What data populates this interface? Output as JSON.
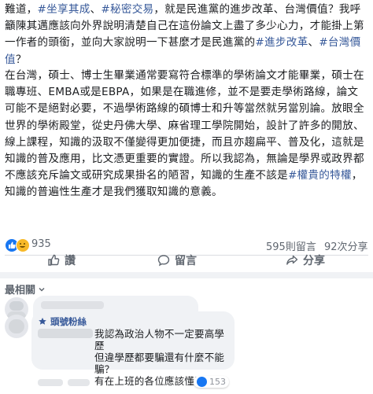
{
  "post": {
    "p1_prefix": "難道，",
    "tags": [
      "#坐享其成",
      "#秘密交易"
    ],
    "p1_middle": "，就是民進黨的進步改革、台灣價值？我呼籲陳其邁應該向外界說明清楚自己在這份論文上盡了多少心力，才能掛上第一作者的頭銜，並向大家說明一下甚麼才是民進黨的",
    "tags2": [
      "#進步改革",
      "#台灣價值"
    ],
    "p1_suffix": "？",
    "p2_a": "在台灣，碩士、博士生畢業通常要寫符合標準的學術論文才能畢業，碩士在職專班、EMBA或是EBPA，如果是在職進修，並不是要走學術路線，論文可能不是絕對必要，不過學術路線的碩博士和升等當然就另當別論。放眼全世界的學術殿堂，從史丹佛大學、麻省理工學院開始，設計了許多的開放、線上課程，知識的汲取不僅變得更加便捷，而且亦趨扁平、普及化，這就是知識的普及應用，比文憑更重要的實證。所以我認為，無論是學界或政界都不應該充斥論文或研究成果掛名的陋習，知識的生產不該是",
    "tag3": "#權貴的特權",
    "p2_b": "，知識的普遍性生產才是我們獲取知識的意義。"
  },
  "stats": {
    "reaction_count": "935",
    "comments": "595則留言",
    "shares": "92次分享"
  },
  "actions": {
    "like": "讚",
    "comment": "留言",
    "share": "分享"
  },
  "comments_section": {
    "sort_label": "最相關",
    "comment2": {
      "badge": "頭號粉絲",
      "text": "我認為政治人物不一定要高學歷\n但違學歷都要騙還有什麼不能騙？\n有在上班的各位應該懂意思吧",
      "meta_count": "153"
    }
  },
  "colors": {
    "link": "#365899",
    "like_blue": "#1877f2",
    "haha_yellow": "#f7b928",
    "muted": "#606770"
  }
}
